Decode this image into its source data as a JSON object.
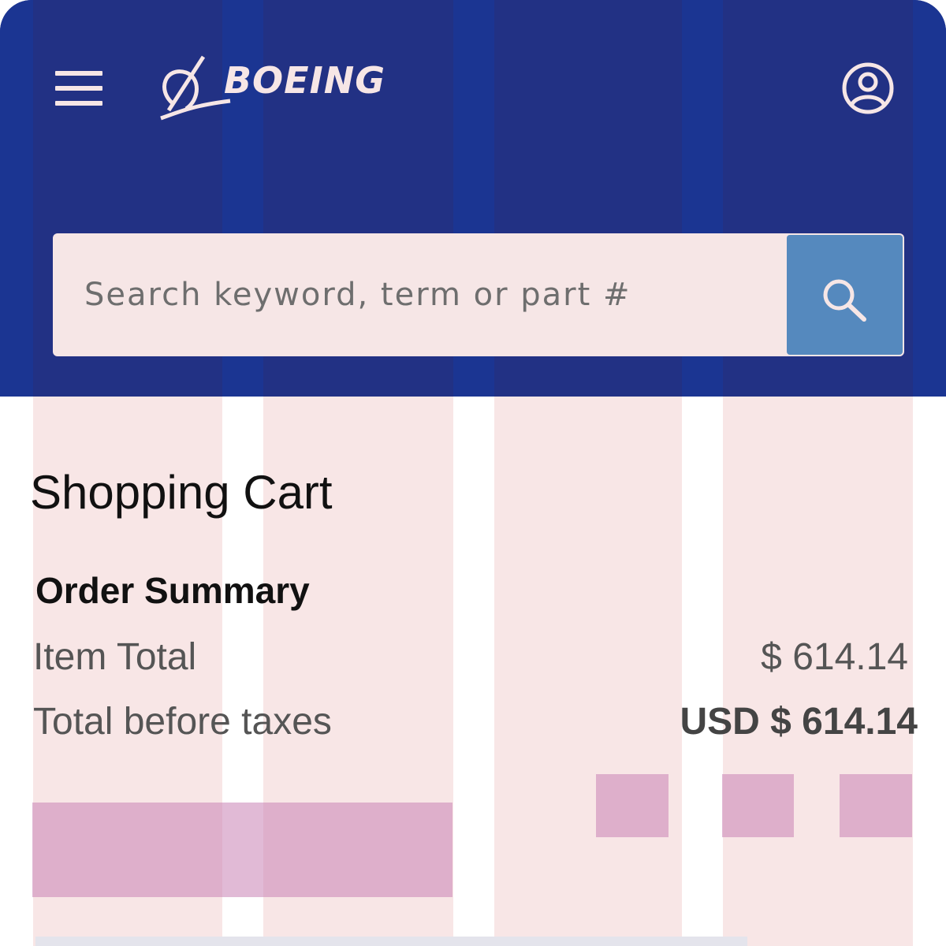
{
  "brand": {
    "name": "BOEING",
    "header_color": "#223184",
    "accent_color": "#5589be"
  },
  "header": {
    "menu_icon": "hamburger-menu-icon",
    "logo": "boeing-logo",
    "account_icon": "user-account-icon"
  },
  "search": {
    "placeholder": "Search keyword, term or part #",
    "button_icon": "search-icon"
  },
  "cart": {
    "title": "Shopping Cart",
    "summary_title": "Order Summary",
    "item_total_label": "Item Total",
    "item_total_value": "$ 614.14",
    "total_label": "Total before taxes",
    "total_value": "USD $ 614.14"
  }
}
